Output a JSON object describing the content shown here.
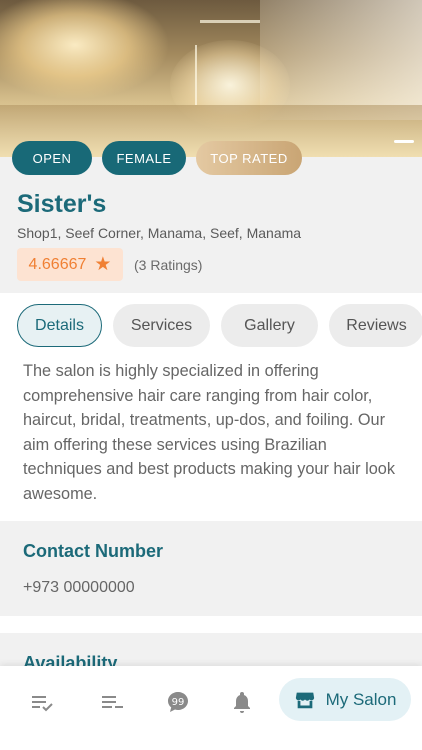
{
  "tags": {
    "open": "OPEN",
    "female": "FEMALE",
    "top_rated": "TOP RATED"
  },
  "salon": {
    "name": "Sister's",
    "address": "Shop1, Seef Corner, Manama, Seef, Manama",
    "rating": "4.66667",
    "ratings_count": "(3 Ratings)"
  },
  "tabs": [
    "Details",
    "Services",
    "Gallery",
    "Reviews"
  ],
  "description": "The salon is highly specialized in offering comprehensive hair care ranging from hair color, haircut, bridal, treatments, up-dos, and foiling. Our aim offering these services using Brazilian techniques and best products making your hair look awesome.",
  "contact": {
    "heading": "Contact Number",
    "phone": "+973 00000000"
  },
  "availability": {
    "heading": "Availability"
  },
  "bottom_nav": {
    "my_salon_label": "My Salon"
  },
  "icons": [
    "list-check-icon",
    "list-icon",
    "chat-icon",
    "bell-icon",
    "store-icon",
    "star-icon"
  ],
  "colors": {
    "primary": "#1c6a79",
    "accent": "#f08034",
    "rating_bg": "#fde3d2"
  }
}
